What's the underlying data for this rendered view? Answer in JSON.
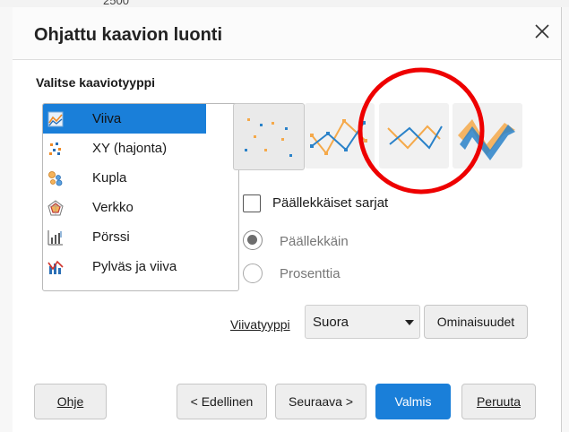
{
  "background": {
    "partial_text": "2500"
  },
  "dialog": {
    "title": "Ohjattu kaavion luonti",
    "close_label": "×"
  },
  "chart_type": {
    "section_label": "Valitse kaaviotyyppi",
    "items": [
      {
        "label": "Viiva",
        "icon": "line-chart-icon",
        "selected": true
      },
      {
        "label": "XY (hajonta)",
        "icon": "scatter-chart-icon",
        "selected": false
      },
      {
        "label": "Kupla",
        "icon": "bubble-chart-icon",
        "selected": false
      },
      {
        "label": "Verkko",
        "icon": "net-chart-icon",
        "selected": false
      },
      {
        "label": "Pörssi",
        "icon": "stock-chart-icon",
        "selected": false
      },
      {
        "label": "Pylväs ja viiva",
        "icon": "column-and-line-chart-icon",
        "selected": false
      }
    ],
    "variants": [
      {
        "name": "points-only",
        "selected": true
      },
      {
        "name": "points-and-lines",
        "selected": false
      },
      {
        "name": "lines-only",
        "selected": false
      },
      {
        "name": "3d-lines",
        "selected": false
      }
    ]
  },
  "options": {
    "stack_series_label": "Päällekkäiset sarjat",
    "stack_series_checked": false,
    "on_top_label": "Päällekkäin",
    "on_top_selected": true,
    "percent_label": "Prosenttia",
    "percent_selected": false
  },
  "line_type": {
    "label": "Viivatyyppi",
    "value": "Suora",
    "properties_label": "Ominaisuudet"
  },
  "footer": {
    "help_label": "Ohje",
    "back_label": "< Edellinen",
    "next_label": "Seuraava >",
    "finish_label": "Valmis",
    "cancel_label": "Peruuta"
  },
  "colors": {
    "accent": "#1a7fd9",
    "annotation_circle": "#ee0000",
    "series_orange": "#f5a94a",
    "series_blue": "#2a82c9"
  }
}
